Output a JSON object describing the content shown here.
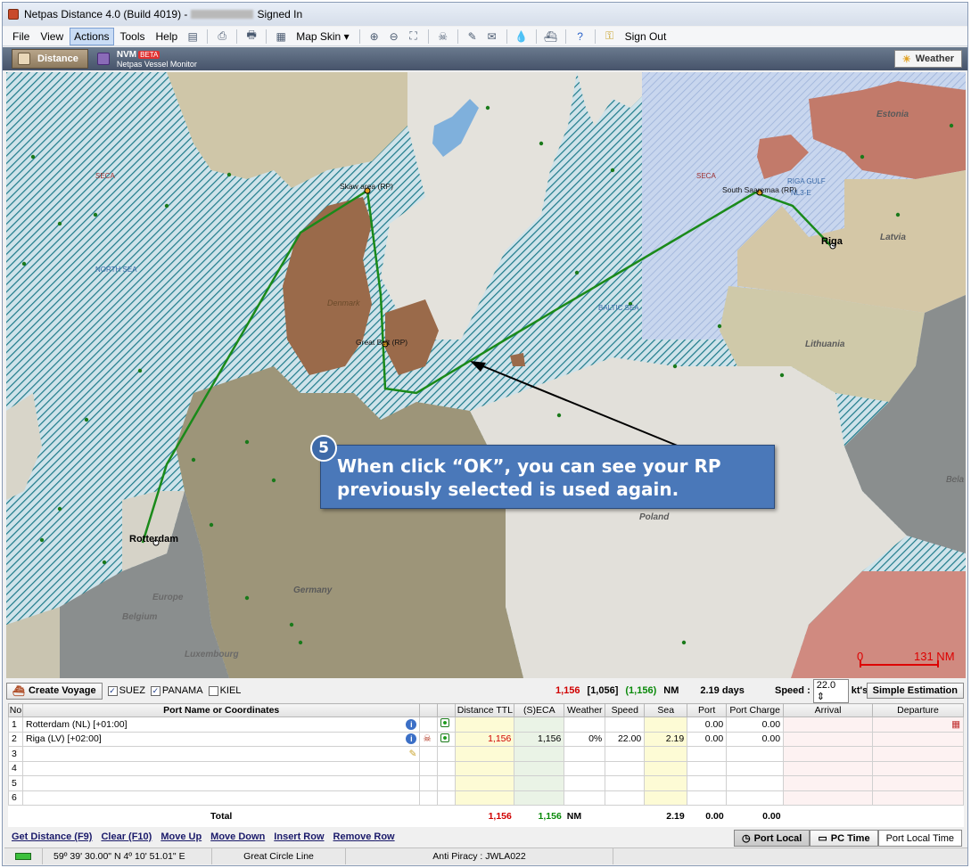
{
  "window": {
    "title": "Netpas Distance 4.0 (Build 4019) -",
    "title_suffix": "Signed In"
  },
  "menu": {
    "items": [
      "File",
      "View",
      "Actions",
      "Tools",
      "Help"
    ],
    "map_skin": "Map Skin",
    "sign_out": "Sign Out"
  },
  "tabs": {
    "distance": "Distance",
    "nvm": "NVM",
    "nvm_badge": "BETA",
    "nvm_sub": "Netpas Vessel Monitor",
    "weather": "Weather"
  },
  "map": {
    "labels": {
      "seca_west": "SECA",
      "seca_east": "SECA",
      "north_sea": "NORTH SEA",
      "baltic_sea": "BALTIC SEA",
      "riga_gulf": "RIGA GULF",
      "estonia": "Estonia",
      "latvia": "Latvia",
      "lithuania": "Lithuania",
      "poland": "Poland",
      "germany": "Germany",
      "europe": "Europe",
      "belgium": "Belgium",
      "luxembourg": "Luxembourg",
      "denmark": "Denmark",
      "belarus": "Bela",
      "skaw": "Skaw area (RP)",
      "great_belt": "Great Belt (RP)",
      "south_saaremaa": "South Saaremaa (RP)",
      "nl3e": "NL3-E",
      "rotterdam": "Rotterdam",
      "riga": "Riga"
    },
    "scale_zero": "0",
    "scale_value": "131 NM"
  },
  "callout": {
    "number": "5",
    "line1": "When click “OK”, you can see your RP",
    "line2": "previously selected is used again."
  },
  "toolbar": {
    "create_voyage": "Create Voyage",
    "suez": "SUEZ",
    "panama": "PANAMA",
    "kiel": "KIEL",
    "total_distance": "1,156",
    "seca_bracket": "[1,056]",
    "seca_paren": "(1,156)",
    "nm": "NM",
    "days": "2.19 days",
    "speed_label": "Speed :",
    "speed_value": "22.0",
    "speed_unit": "kt's",
    "simple_estimation": "Simple Estimation"
  },
  "grid": {
    "headers": [
      "No",
      "Port Name or Coordinates",
      "Distance TTL",
      "(S)ECA",
      "Weather",
      "Speed",
      "Sea",
      "Port",
      "Port Charge",
      "Arrival",
      "Departure"
    ],
    "rows": [
      {
        "no": "1",
        "port": "Rotterdam (NL) [+01:00]",
        "dist": "",
        "seca": "",
        "weather": "",
        "speed": "",
        "sea": "",
        "portd": "0.00",
        "charge": "0.00"
      },
      {
        "no": "2",
        "port": "Riga (LV) [+02:00]",
        "dist": "1,156",
        "seca": "1,156",
        "weather": "0%",
        "speed": "22.00",
        "sea": "2.19",
        "portd": "0.00",
        "charge": "0.00"
      },
      {
        "no": "3",
        "port": "",
        "dist": "",
        "seca": "",
        "weather": "",
        "speed": "",
        "sea": "",
        "portd": "",
        "charge": ""
      },
      {
        "no": "4",
        "port": "",
        "dist": "",
        "seca": "",
        "weather": "",
        "speed": "",
        "sea": "",
        "portd": "",
        "charge": ""
      },
      {
        "no": "5",
        "port": "",
        "dist": "",
        "seca": "",
        "weather": "",
        "speed": "",
        "sea": "",
        "portd": "",
        "charge": ""
      },
      {
        "no": "6",
        "port": "",
        "dist": "",
        "seca": "",
        "weather": "",
        "speed": "",
        "sea": "",
        "portd": "",
        "charge": ""
      }
    ],
    "total": {
      "label": "Total",
      "dist": "1,156",
      "seca": "1,156",
      "nm": "NM",
      "sea": "2.19",
      "port": "0.00",
      "charge": "0.00"
    }
  },
  "links": [
    "Get Distance (F9)",
    "Clear (F10)",
    "Move Up",
    "Move Down",
    "Insert Row",
    "Remove Row"
  ],
  "time_buttons": {
    "port_local": "Port Local",
    "pc_time": "PC Time",
    "port_local_time": "Port Local Time"
  },
  "status": {
    "coords": "59º 39' 30.00\" N 4º 10' 51.01\" E",
    "route_type": "Great Circle Line",
    "anti_piracy": "Anti Piracy : JWLA022"
  },
  "colors": {
    "seca_hatch": "#1d7a8a",
    "route": "#1a8a1a",
    "callout": "#4a78b9",
    "land_tan": "#d4c7a6",
    "denmark": "#9a6a4a",
    "estonia": "#c27a6a"
  }
}
